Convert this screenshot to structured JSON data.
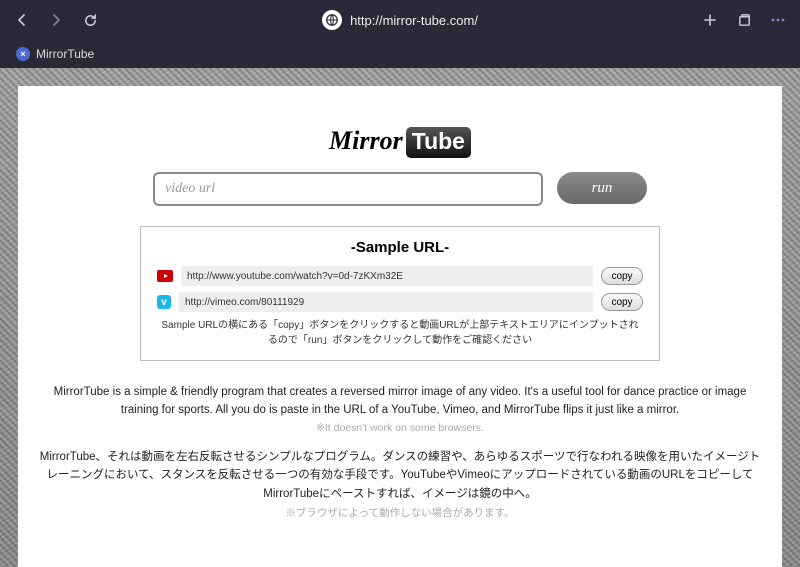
{
  "browser": {
    "url": "http://mirror-tube.com/",
    "tab_title": "MirrorTube",
    "tab_favicon": "×"
  },
  "logo": {
    "part1": "Mirror",
    "part2": "Tube"
  },
  "input": {
    "placeholder": "video url"
  },
  "run_label": "run",
  "sample": {
    "title": "-Sample URL-",
    "rows": [
      {
        "url": "http://www.youtube.com/watch?v=0d-7zKXm32E",
        "copy": "copy"
      },
      {
        "url": "http://vimeo.com/80111929",
        "copy": "copy"
      }
    ],
    "note": "Sample URLの横にある「copy」ボタンをクリックすると動画URLが上部テキストエリアにインプットされるので「run」ボタンをクリックして動作をご確認ください"
  },
  "desc_en": "MirrorTube is a simple & friendly program that creates a reversed mirror image of any video. It's a useful tool for dance practice or image training for sports. All you do is paste in the URL of a YouTube, Vimeo, and MirrorTube flips it just like a mirror.",
  "desc_en_sub": "※It doesn't work on some browsers.",
  "desc_jp": "MirrorTube、それは動画を左右反転させるシンプルなプログラム。ダンスの練習や、あらゆるスポーツで行なわれる映像を用いたイメージトレーニングにおいて、スタンスを反転させる一つの有効な手段です。YouTubeやVimeoにアップロードされている動画のURLをコピーしてMirrorTubeにペーストすれば、イメージは鏡の中へ。",
  "desc_jp_sub": "※ブラウザによって動作しない場合があります。"
}
